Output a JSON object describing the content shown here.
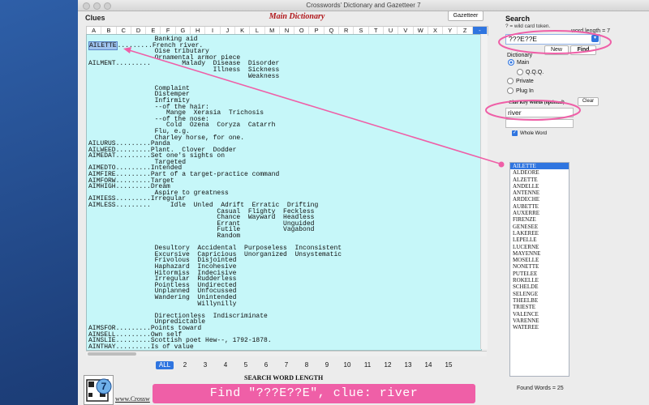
{
  "window": {
    "title": "Crosswords' Dictionary and Gazetteer 7"
  },
  "clues_pane": {
    "label": "Clues",
    "dictionary_title": "Main Dictionary",
    "gazetteer_button": "Gazetteer",
    "letters": [
      "A",
      "B",
      "C",
      "D",
      "E",
      "F",
      "G",
      "H",
      "I",
      "J",
      "K",
      "L",
      "M",
      "N",
      "O",
      "P",
      "Q",
      "R",
      "S",
      "T",
      "U",
      "V",
      "W",
      "X",
      "Y",
      "Z",
      "-"
    ],
    "selected_letter": "-",
    "highlighted_word": "AILETTE",
    "lines": [
      "                 Banking aid",
      "AILETTE.........French river.",
      "                 Oise tributary",
      "                 Ornamental armor piece",
      "AILMENT.........        Malady  Disease  Disorder",
      "                                Illness  Sickness",
      "                                         Weakness",
      "",
      "                 Complaint",
      "                 Distemper",
      "                 Infirmity",
      "                 --of the hair:",
      "                    Mange  Xerasia  Trichosis",
      "                 --of the nose:",
      "                    Cold  Ozena  Coryza  Catarrh",
      "                 Flu, e.g.",
      "                 Charley horse, for one.",
      "AILURUS.........Panda",
      "AILWEED.........Plant.  Clover  Dodder",
      "AIMEDAT.........Set one's sights on",
      "                 Targeted",
      "AIMEDTO.........Intended",
      "AIMFIRE.........Part of a target-practice command",
      "AIMFORW.........Target",
      "AIMHIGH.........Dream",
      "                 Aspire to greatness",
      "AIMIESS.........Irregular",
      "AIMLESS.........     Idle  Unled  Adrift  Erratic  Drifting",
      "                                 Casual  Flighty  Feckless",
      "                                 Chance  Wayward  Headless",
      "                                 Errant           Unguided",
      "                                 Futile           Vagabond",
      "                                 Random",
      "",
      "                 Desultory  Accidental  Purposeless  Inconsistent",
      "                 Excursive  Capricious  Unorganized  Unsystematic",
      "                 Frivolous  Disjointed",
      "                 Haphazard  Incohesive",
      "                 Hitormiss  Indecisive",
      "                 Irregular  Rudderless",
      "                 Pointless  Undirected",
      "                 Unplanned  Unfocussed",
      "                 Wandering  Unintended",
      "                            Willynilly",
      "",
      "                 Directionless  Indiscriminate",
      "                 Unpredictable",
      "AIMSFOR.........Points toward",
      "AINSELL.........Own self",
      "AINSLIE.........Scottish poet Hew--, 1792-1878.",
      "AINTHAY.........Is of value"
    ]
  },
  "length_bar": {
    "buttons": [
      "ALL",
      "2",
      "3",
      "4",
      "5",
      "6",
      "7",
      "8",
      "9",
      "10",
      "11",
      "12",
      "13",
      "14",
      "15"
    ],
    "selected": "ALL",
    "label": "SEARCH WORD LENGTH"
  },
  "logo": {
    "icon": "die-seven-icon",
    "site_text": "www.Crossw"
  },
  "search_panel": {
    "label": "Search",
    "wildcard_hint": "? = wild card token.",
    "word_length_label": "word length = 7",
    "pattern": "???E??E",
    "new_button": "New",
    "find_button": "Find",
    "dictionary_label": "Dictionary",
    "radios": [
      {
        "label": "Main",
        "checked": true
      },
      {
        "label": "Q.Q.Q.",
        "checked": false
      },
      {
        "label": "Private",
        "checked": false
      },
      {
        "label": "Plug In",
        "checked": false
      }
    ],
    "clear_button": "Clear",
    "clue_keywords_label": "Clue Key Words  (optional)",
    "clue_keyword": "river",
    "whole_word_label": "Whole Word",
    "whole_word_checked": true
  },
  "results": {
    "items": [
      "AILETTE",
      "ALDEORE",
      "ALZETTE",
      "ANDELLE",
      "ANTENNE",
      "ARDECHE",
      "AUBETTE",
      "AUXERRE",
      "FIRENZE",
      "GENESEE",
      "LAKEREE",
      "LEPELLE",
      "LUCERNE",
      "MAYENNE",
      "MOSELLE",
      "NONETTE",
      "PUTELEE",
      "ROKELLE",
      "SCHELDE",
      "SELENGE",
      "THEELBE",
      "TRIESTE",
      "VALENCE",
      "VARENNE",
      "WATEREE"
    ],
    "selected": "AILETTE",
    "found_label": "Found Words = 25"
  },
  "banner": {
    "text": "Find \"???E??E\", clue: river"
  },
  "colors": {
    "accent": "#2f75e0",
    "annotation": "#ef5fa7",
    "clue_background": "#c6f7f9",
    "title_red": "#b0161a"
  }
}
